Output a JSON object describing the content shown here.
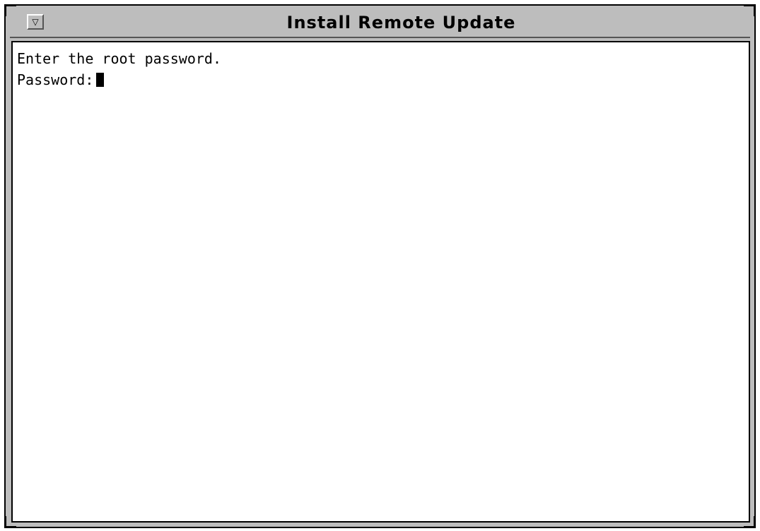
{
  "window": {
    "title": "Install Remote Update",
    "menu_button_glyph": "▽"
  },
  "terminal": {
    "lines": [
      "Enter the root password.",
      "Password:"
    ]
  },
  "colors": {
    "frame": "#bdbdbd",
    "background": "#ffffff",
    "text": "#000000"
  }
}
